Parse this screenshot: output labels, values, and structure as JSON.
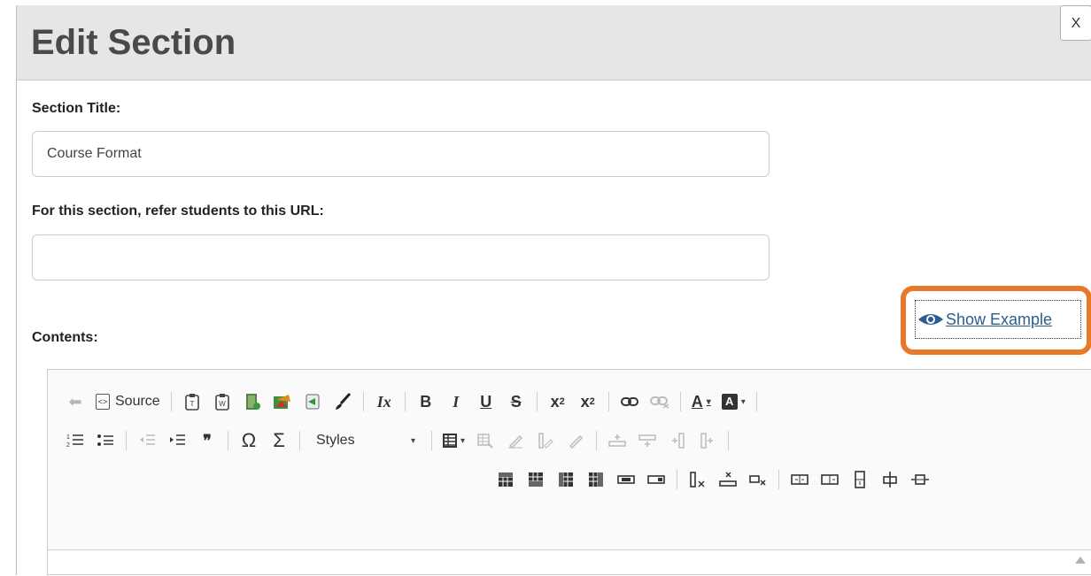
{
  "dialog": {
    "title": "Edit Section",
    "close_label": "X"
  },
  "form": {
    "section_title_label": "Section Title:",
    "section_title_value": "Course Format",
    "url_label": "For this section, refer students to this URL:",
    "url_value": "",
    "show_example_label": "Show Example",
    "contents_label": "Contents:"
  },
  "editor": {
    "source_label": "Source",
    "styles_label": "Styles",
    "undo_glyph": "⬅",
    "clear_format_glyph": "Ix",
    "bold_glyph": "B",
    "italic_glyph": "I",
    "underline_glyph": "U",
    "strike_glyph": "S",
    "subscript_glyph": "x",
    "subscript_mark": "2",
    "superscript_glyph": "x",
    "superscript_mark": "2",
    "text_color_glyph": "A",
    "bg_color_glyph": "A",
    "blockquote_glyph": "❞",
    "special_char_glyph": "Ω",
    "math_glyph": "Σ"
  },
  "colors": {
    "highlight": "#e8782a",
    "link": "#2a5d91",
    "header_bg": "#e6e6e6"
  }
}
